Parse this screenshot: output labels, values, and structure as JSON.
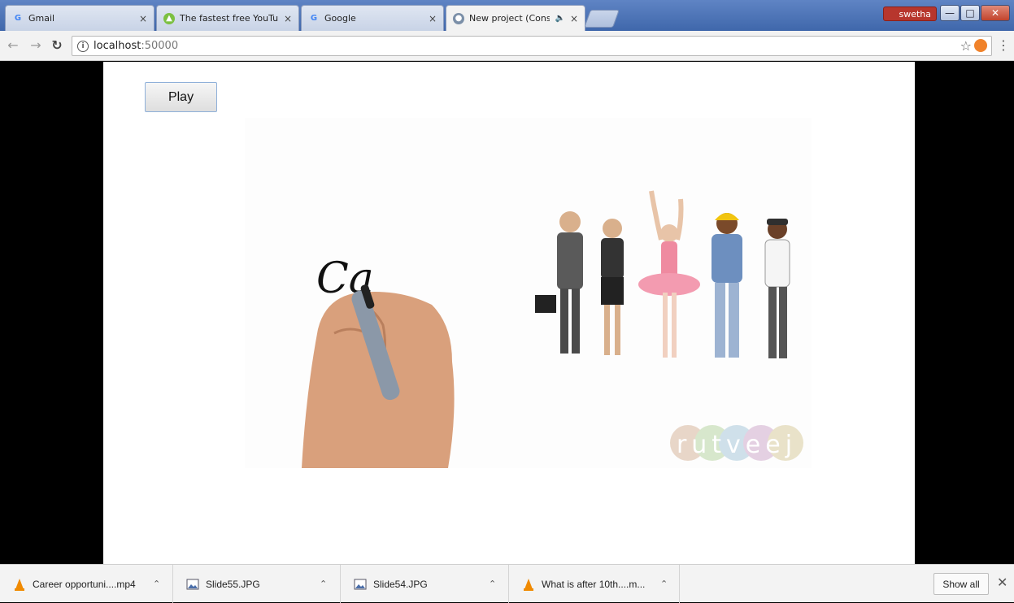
{
  "tabs": [
    {
      "label": "Gmail",
      "icon": "google-g-icon"
    },
    {
      "label": "The fastest free YouTube",
      "icon": "android-icon"
    },
    {
      "label": "Google",
      "icon": "google-g-icon"
    },
    {
      "label": "New project (Construc",
      "icon": "app-icon",
      "audio": "🔈"
    }
  ],
  "tab_close": "×",
  "profile": {
    "name": "swetha"
  },
  "address": {
    "host": "localhost",
    "port": ":50000"
  },
  "page": {
    "play_label": "Play",
    "video_handwriting": "Ca",
    "video_watermark": "rutveej"
  },
  "downloads": [
    {
      "name": "Career opportuni....mp4",
      "type": "vlc"
    },
    {
      "name": "Slide55.JPG",
      "type": "image"
    },
    {
      "name": "Slide54.JPG",
      "type": "image"
    },
    {
      "name": "What is after 10th....m...",
      "type": "vlc"
    }
  ],
  "downloads_show_all": "Show all",
  "colors": {
    "titlebar": "#4a71b5",
    "active_tab": "#f2f2f2",
    "vlc": "#f08a00"
  }
}
